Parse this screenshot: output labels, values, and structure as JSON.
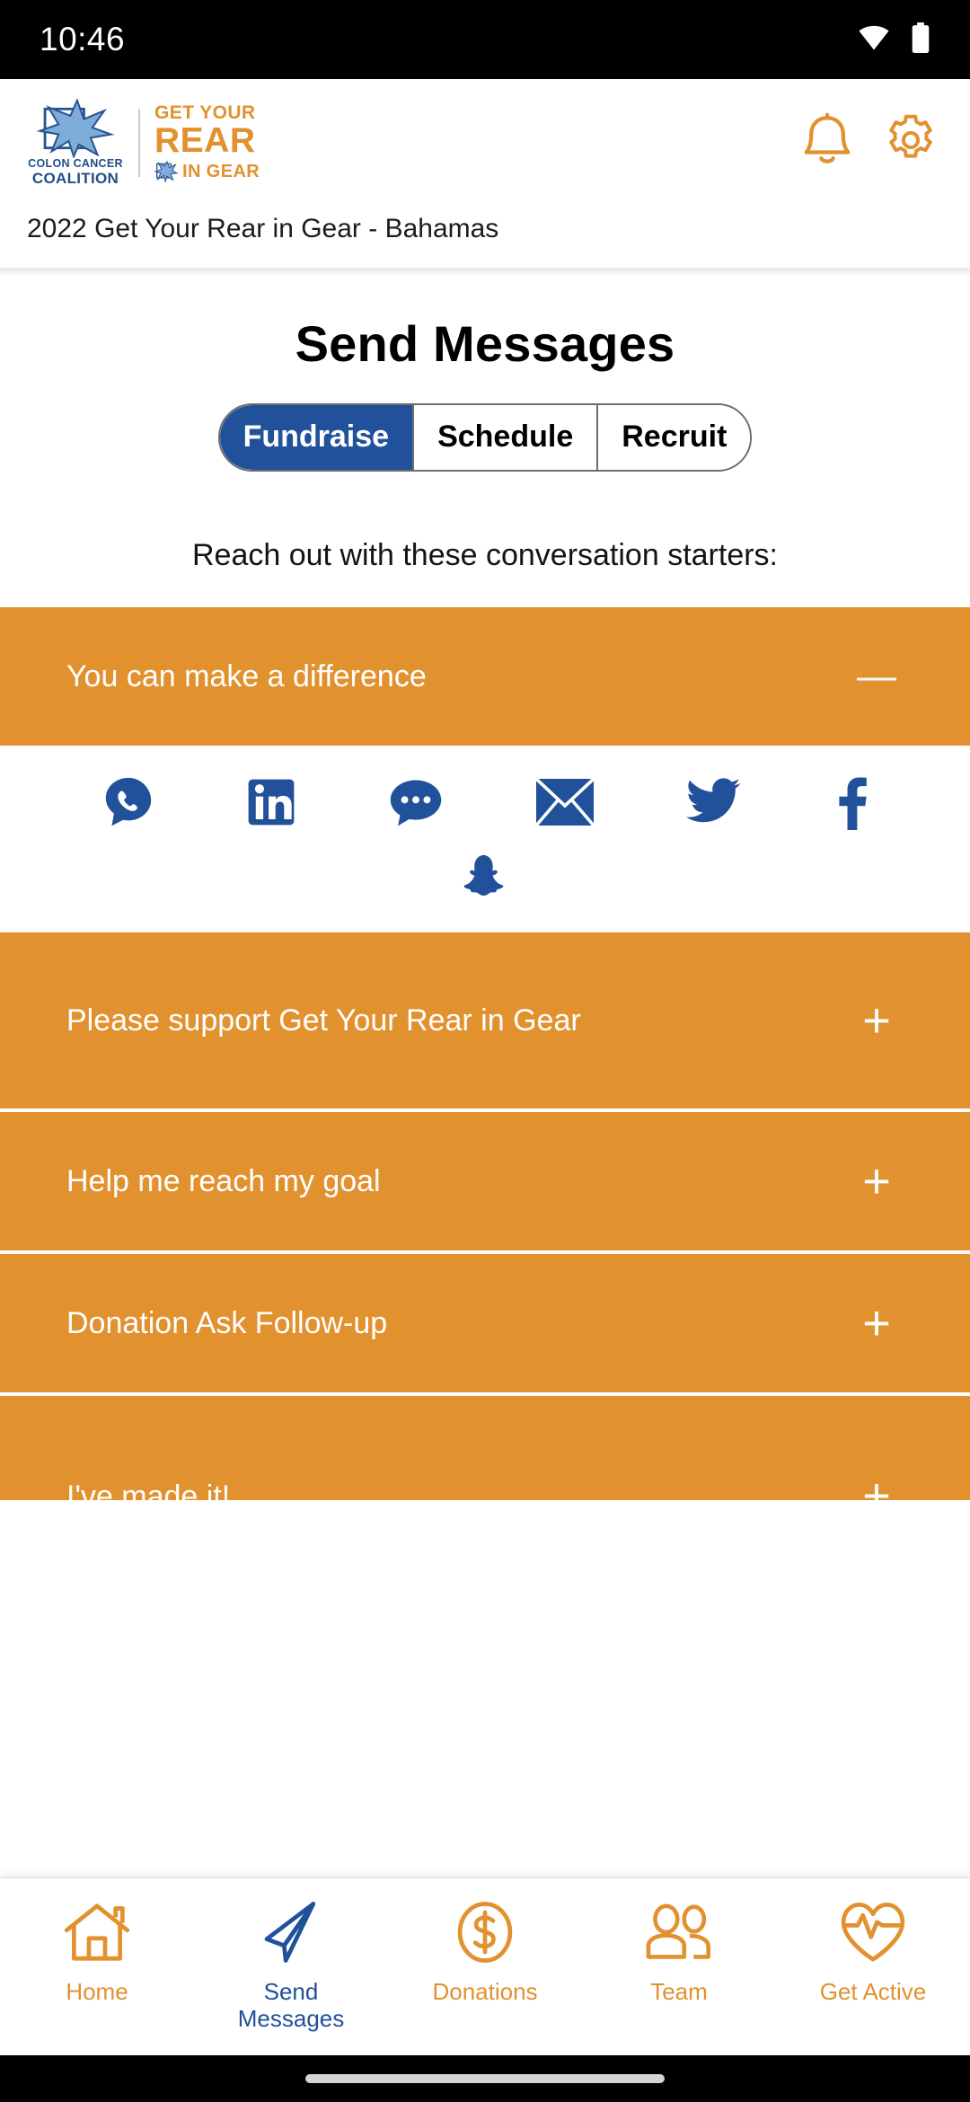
{
  "status_bar": {
    "time": "10:46",
    "wifi_icon": "wifi-icon",
    "battery_icon": "battery-icon"
  },
  "header": {
    "logo": {
      "org_line1": "COLON CANCER",
      "org_line2": "COALITION",
      "brand_line1": "GET YOUR",
      "brand_line2": "REAR",
      "brand_line3": "IN GEAR",
      "star_icon": "starburst-logo-icon"
    },
    "notifications_icon": "bell-icon",
    "settings_icon": "gear-icon",
    "event_title": "2022 Get Your Rear in Gear - Bahamas"
  },
  "main": {
    "page_title": "Send Messages",
    "tabs": [
      {
        "label": "Fundraise",
        "active": true
      },
      {
        "label": "Schedule",
        "active": false
      },
      {
        "label": "Recruit",
        "active": false
      }
    ],
    "subtitle": "Reach out with these conversation starters:",
    "accordion": [
      {
        "title": "You can make a difference",
        "expanded": true,
        "sign": "—"
      },
      {
        "title": "Please support Get Your Rear in Gear",
        "expanded": false,
        "sign": "+"
      },
      {
        "title": "Help me reach my goal",
        "expanded": false,
        "sign": "+"
      },
      {
        "title": "Donation Ask Follow-up",
        "expanded": false,
        "sign": "+"
      },
      {
        "title": "I've made it!",
        "expanded": false,
        "sign": "+"
      }
    ],
    "share_icons": [
      {
        "name": "whatsapp-icon"
      },
      {
        "name": "linkedin-icon"
      },
      {
        "name": "sms-chat-icon"
      },
      {
        "name": "email-icon"
      },
      {
        "name": "twitter-icon"
      },
      {
        "name": "facebook-icon"
      },
      {
        "name": "snapchat-icon"
      }
    ]
  },
  "bottom_nav": [
    {
      "label": "Home",
      "icon": "home-icon",
      "active": false
    },
    {
      "label": "Send\nMessages",
      "label_line1": "Send",
      "label_line2": "Messages",
      "icon": "paper-plane-icon",
      "active": true
    },
    {
      "label": "Donations",
      "icon": "dollar-circle-icon",
      "active": false
    },
    {
      "label": "Team",
      "icon": "people-icon",
      "active": false
    },
    {
      "label": "Get Active",
      "icon": "heart-pulse-icon",
      "active": false
    }
  ],
  "colors": {
    "orange": "#e2912f",
    "blue": "#22519b",
    "social_blue": "#22519b",
    "status_bar_bg": "#000000",
    "logo_star_blue": "#7fadd9"
  }
}
